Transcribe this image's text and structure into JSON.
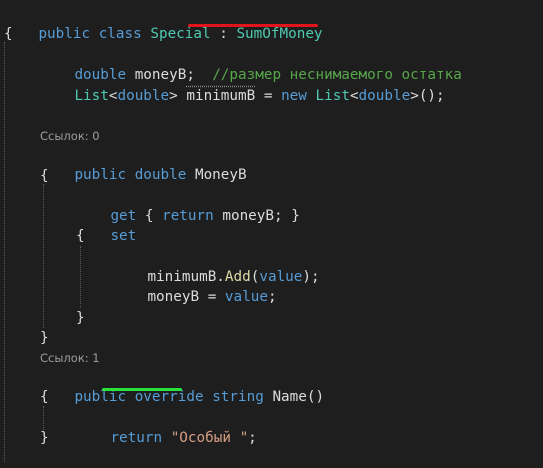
{
  "code": {
    "l1": {
      "public": "public",
      "class": "class",
      "classname": "Special",
      "colon": " : ",
      "base": "SumOfMoney"
    },
    "l2": "{",
    "l3": {
      "type": "double",
      "name": "moneyB;",
      "comment": "//размер неснимаемого остатка"
    },
    "l4": {
      "list": "List",
      "lt": "<",
      "double": "double",
      "gt": ">",
      "name": "minimumB",
      "eq": " = ",
      "new": "new",
      "list2": "List",
      "lt2": "<",
      "double2": "double",
      "gt2": ">",
      "end": "();"
    },
    "lens1": "Ссылок: 0",
    "l7": {
      "public": "public",
      "type": "double",
      "name": "MoneyB"
    },
    "l8": "{",
    "l9": {
      "get": "get",
      "open": "{ ",
      "return": "return",
      "name": "moneyB;",
      "close": " }"
    },
    "l10": {
      "set": "set"
    },
    "l11": "{",
    "l12": {
      "obj": "minimumB.",
      "method": "Add",
      "open": "(",
      "value": "value",
      "close": ");"
    },
    "l13": {
      "name": "moneyB",
      "eq": " = ",
      "value": "value",
      "end": ";"
    },
    "l15": "}",
    "l16": "}",
    "lens2": "Ссылок: 1",
    "l17": {
      "public": "public",
      "override": "override",
      "string": "string",
      "name": "Name",
      "paren": "()"
    },
    "l18": "{",
    "l19": {
      "return": "return",
      "str": "\"Особый \"",
      "end": ";"
    },
    "l20": "}"
  },
  "colors": {
    "keyword": "#569cd6",
    "type": "#4ec9b0",
    "method": "#dcdcaa",
    "string": "#d69d85",
    "comment": "#57a64a",
    "text": "#dcdcdc",
    "background": "#1e1e1e",
    "underline_red": "#e2141b",
    "underline_green": "#27e23a"
  }
}
